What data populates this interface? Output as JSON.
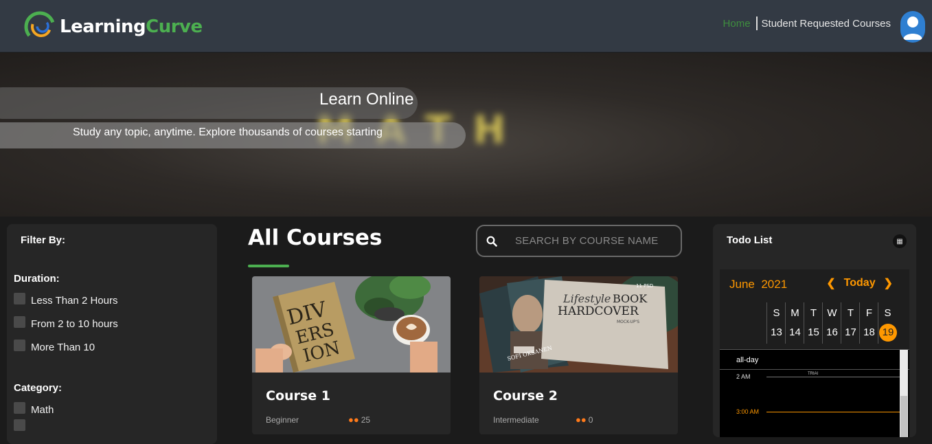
{
  "header": {
    "logo_part1": "Learning",
    "logo_part2": "Curve",
    "nav": {
      "home": "Home",
      "requested": "Student Requested Courses"
    }
  },
  "hero": {
    "title": "Learn Online",
    "subtitle": "Study any topic, anytime. Explore thousands of courses starting",
    "background_word": "MATH"
  },
  "filter": {
    "title": "Filter By:",
    "duration_title": "Duration:",
    "duration_options": [
      "Less Than 2 Hours",
      "From 2 to 10 hours",
      "More Than 10"
    ],
    "category_title": "Category:",
    "category_options": [
      "Math"
    ]
  },
  "main": {
    "title": "All Courses",
    "search_placeholder": "SEARCH BY COURSE NAME",
    "courses": [
      {
        "title": "Course 1",
        "level": "Beginner",
        "students": "25",
        "cover_text": "DIVERSION"
      },
      {
        "title": "Course 2",
        "level": "Intermediate",
        "students": "0",
        "cover_text_1": "Lifestyle",
        "cover_text_2": "BOOK",
        "cover_text_3": "HARDCOVER",
        "cover_text_4": "MOCK-UP'S",
        "cover_text_5": "11 PSD",
        "cover_text_6": "SOFI OKSANEN"
      }
    ]
  },
  "todo": {
    "title": "Todo List",
    "calendar": {
      "month": "June",
      "year": "2021",
      "today_label": "Today",
      "days": [
        "S",
        "M",
        "T",
        "W",
        "T",
        "F",
        "S"
      ],
      "dates": [
        "13",
        "14",
        "15",
        "16",
        "17",
        "18",
        "19"
      ],
      "today_date": "19",
      "allday_label": "all-day",
      "times": [
        "2 AM",
        "3:00 AM"
      ],
      "event_label": "TRIAl"
    }
  },
  "colors": {
    "accent_green": "#4caf50",
    "accent_orange": "#ff9800",
    "header_bg": "#333a44"
  }
}
